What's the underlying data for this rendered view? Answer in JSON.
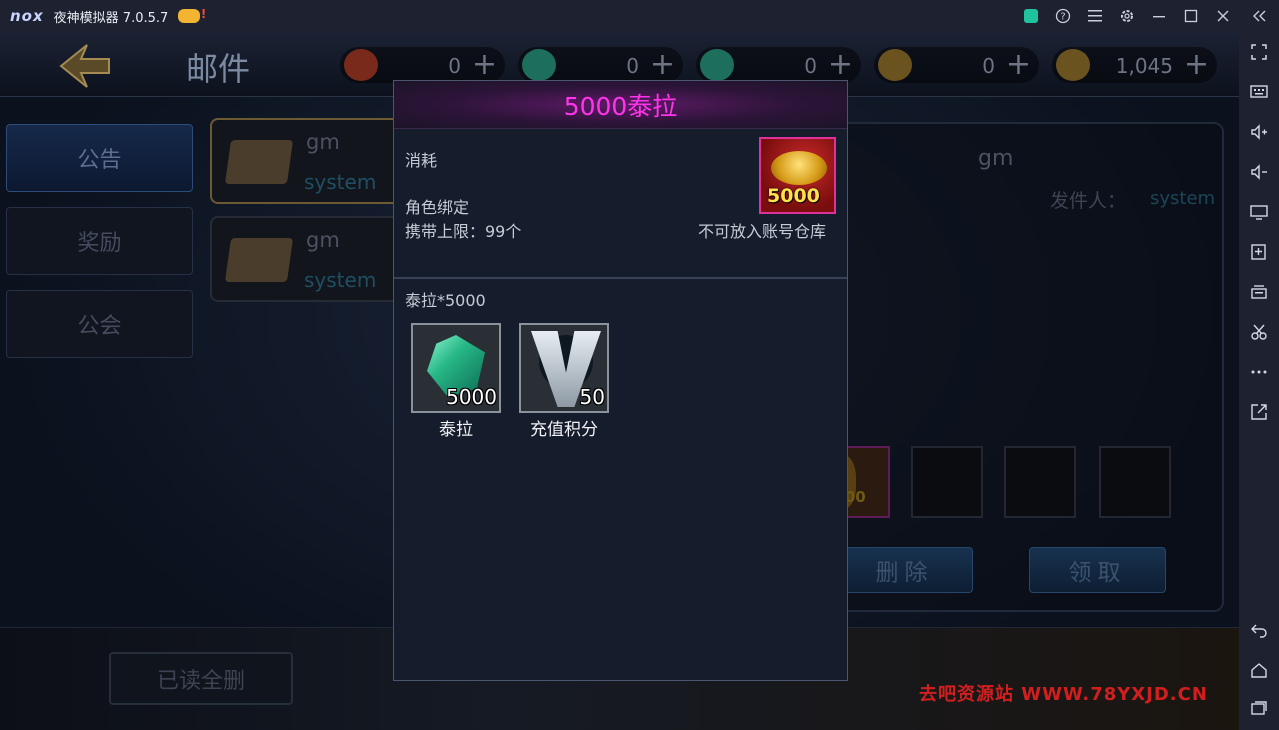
{
  "emulator": {
    "logo": "nox",
    "title": "夜神模拟器 7.0.5.7",
    "controls": [
      "keyboard-icon",
      "help-icon",
      "menu-icon",
      "settings-icon",
      "minimize-icon",
      "maximize-icon",
      "close-icon",
      "collapse-icon"
    ],
    "sidebar_icons": [
      "fullscreen-icon",
      "keyboard-icon",
      "volume-up-icon",
      "volume-down-icon",
      "screen-icon",
      "add-apk-icon",
      "multi-instance-icon",
      "screenshot-icon",
      "more-icon",
      "export-icon",
      "back-icon",
      "home-icon",
      "recent-apps-icon"
    ]
  },
  "game": {
    "page_title": "邮件",
    "resources": [
      {
        "name": "scroll",
        "value": "0",
        "color": "#7a2a1a"
      },
      {
        "name": "gem",
        "value": "0",
        "color": "#1d6e5a"
      },
      {
        "name": "gem-2",
        "value": "0",
        "color": "#1d6e5a"
      },
      {
        "name": "coin",
        "value": "0",
        "color": "#6b5320"
      },
      {
        "name": "gold",
        "value": "1,045",
        "color": "#6b5320"
      }
    ],
    "tabs": [
      {
        "label": "公告",
        "active": true
      },
      {
        "label": "奖励",
        "active": false
      },
      {
        "label": "公会",
        "active": false
      }
    ],
    "mails": [
      {
        "sender": "gm",
        "from": "system",
        "active": true
      },
      {
        "sender": "gm",
        "from": "system",
        "active": false
      }
    ],
    "detail": {
      "title": "gm",
      "sender_label": "发件人：",
      "sender_value": "system",
      "attachment_badge": "5000",
      "delete_label": "删除",
      "claim_label": "领取"
    },
    "delete_all_label": "已读全删"
  },
  "popup": {
    "title": "5000泰拉",
    "type_label": "消耗",
    "bind_label": "角色绑定",
    "limit_label": "携带上限：99个",
    "storage_label": "不可放入账号仓库",
    "icon_number": "5000",
    "contents_label": "泰拉*5000",
    "rewards": [
      {
        "name": "泰拉",
        "count": "5000"
      },
      {
        "name": "充值积分",
        "count": "50"
      }
    ],
    "title_color": "#ff34ea"
  },
  "watermark": "去吧资源站 WWW.78YXJD.CN"
}
